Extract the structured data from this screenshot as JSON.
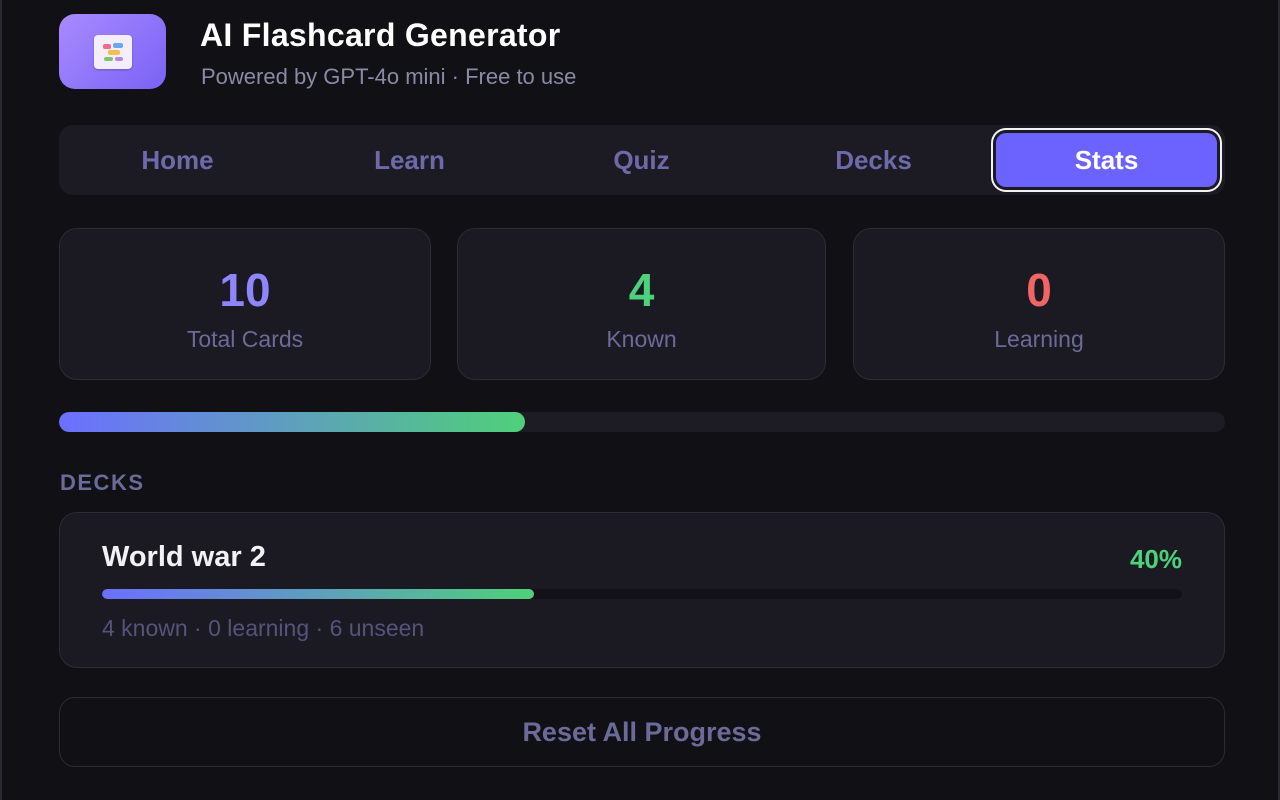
{
  "app": {
    "title": "AI Flashcard Generator",
    "subtitle": "Powered by GPT-4o mini · Free to use",
    "logo_icon": "flashcard-icon"
  },
  "tabs": [
    {
      "label": "Home",
      "active": false
    },
    {
      "label": "Learn",
      "active": false
    },
    {
      "label": "Quiz",
      "active": false
    },
    {
      "label": "Decks",
      "active": false
    },
    {
      "label": "Stats",
      "active": true
    }
  ],
  "stats": {
    "total": {
      "value": "10",
      "label": "Total Cards",
      "color": "#8f86ff"
    },
    "known": {
      "value": "4",
      "label": "Known",
      "color": "#4cd27a"
    },
    "learning": {
      "value": "0",
      "label": "Learning",
      "color": "#f26565"
    }
  },
  "overall_progress_percent": 40,
  "decks_section": {
    "label": "DECKS",
    "items": [
      {
        "name": "World war 2",
        "percent_label": "40%",
        "percent": 40,
        "meta": "4 known · 0 learning · 6 unseen"
      }
    ]
  },
  "reset_button": {
    "label": "Reset All Progress"
  },
  "colors": {
    "accent": "#6c63ff",
    "success": "#4cd27a",
    "danger": "#f26565",
    "background": "#111014",
    "card": "#1b1a22"
  }
}
